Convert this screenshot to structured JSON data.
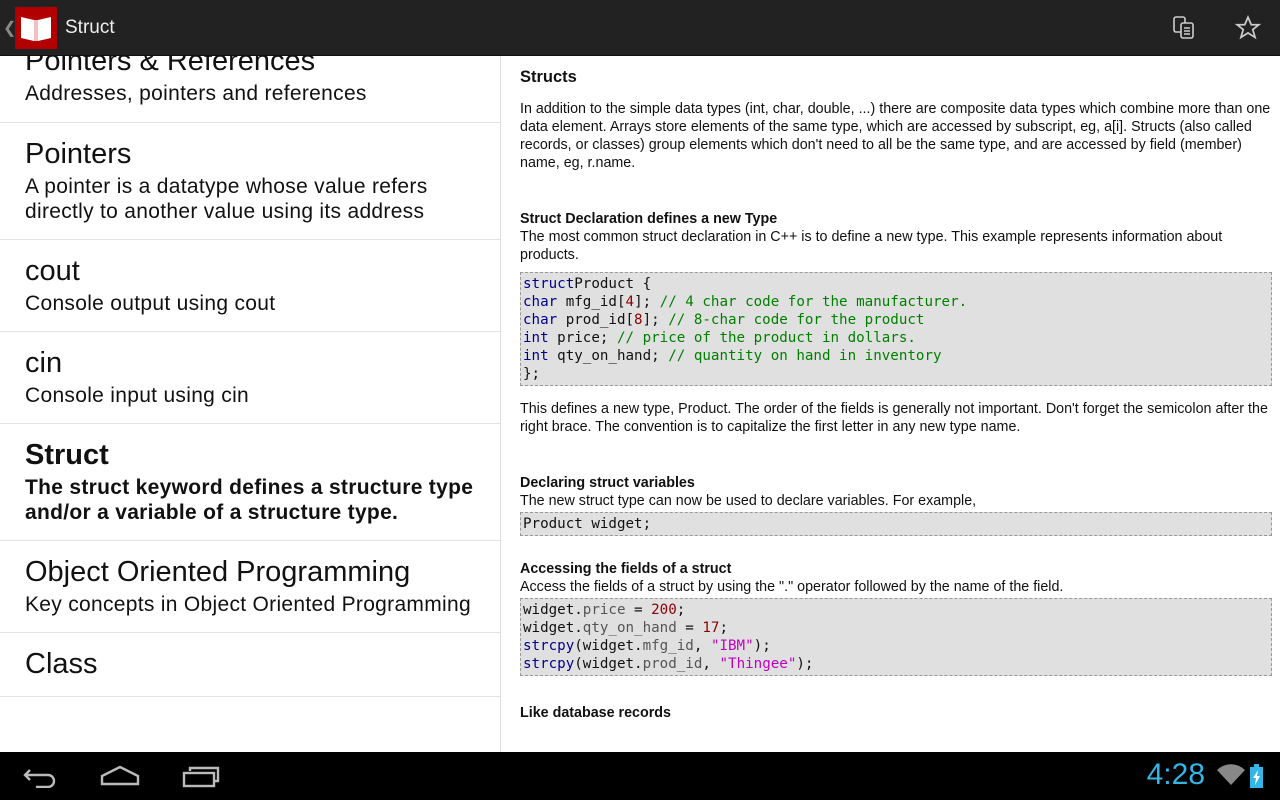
{
  "app": {
    "title": "Struct",
    "back_icon": "chevron-left-icon",
    "logo_icon": "book-icon",
    "actions": [
      "copy-icon",
      "star-icon"
    ]
  },
  "topics": [
    {
      "title": "Pointers & References",
      "desc": "Addresses, pointers and references"
    },
    {
      "title": "Pointers",
      "desc": "A pointer is a datatype whose value refers directly to another value using its address"
    },
    {
      "title": "cout",
      "desc": "Console output using cout"
    },
    {
      "title": "cin",
      "desc": "Console input using cin"
    },
    {
      "title": "Struct",
      "desc": "The struct keyword defines a structure type and/or a variable of a structure type.",
      "selected": true
    },
    {
      "title": "Object Oriented Programming",
      "desc": "Key concepts in Object Oriented Programming"
    },
    {
      "title": "Class",
      "desc": ""
    }
  ],
  "content": {
    "heading": "Structs",
    "intro": "In addition to the simple data types (int, char, double, ...) there are composite data types which combine more than one data element. Arrays store elements of the same type, which are accessed by subscript, eg, a[i]. Structs (also called records, or classes) group elements which don't need to all be the same type, and are accessed by field (member) name, eg, r.name.",
    "s1_title": "Struct Declaration defines a new Type",
    "s1_text": "The most common struct declaration in C++ is to define a new type. This example represents information about products.",
    "s1_after": "This defines a new type, Product. The order of the fields is generally not important. Don't forget the semicolon after the right brace. The convention is to capitalize the first letter in any new type name.",
    "s2_title": "Declaring struct variables",
    "s2_text": "The new struct type can now be used to declare variables. For example,",
    "s2_code": "Product widget;",
    "s3_title": "Accessing the fields of a struct",
    "s3_text": "Access the fields of a struct by using the \".\" operator followed by the name of the field.",
    "s4_title": "Like database records",
    "code1": [
      [
        [
          "kw",
          "struct"
        ],
        [
          "",
          "Product {"
        ]
      ],
      [
        [
          "kw",
          "char"
        ],
        [
          "",
          " mfg_id["
        ],
        [
          "num",
          "4"
        ],
        [
          "",
          "]; "
        ],
        [
          "cm",
          "// 4 char code for the manufacturer."
        ]
      ],
      [
        [
          "kw",
          "char"
        ],
        [
          "",
          " prod_id["
        ],
        [
          "num",
          "8"
        ],
        [
          "",
          "]; "
        ],
        [
          "cm",
          "// 8-char code for the product"
        ]
      ],
      [
        [
          "kw",
          "int"
        ],
        [
          "",
          " price; "
        ],
        [
          "cm",
          "// price of the product in dollars."
        ]
      ],
      [
        [
          "kw",
          "int"
        ],
        [
          "",
          " qty_on_hand; "
        ],
        [
          "cm",
          "// quantity on hand in inventory"
        ]
      ],
      [
        [
          "",
          "};"
        ]
      ]
    ],
    "code3": [
      [
        [
          "",
          "widget."
        ],
        [
          "fld",
          "price"
        ],
        [
          "",
          " = "
        ],
        [
          "num",
          "200"
        ],
        [
          "",
          ";"
        ]
      ],
      [
        [
          "",
          "widget."
        ],
        [
          "fld",
          "qty_on_hand"
        ],
        [
          "",
          " = "
        ],
        [
          "num",
          "17"
        ],
        [
          "",
          ";"
        ]
      ],
      [
        [
          "kw",
          "strcpy"
        ],
        [
          "",
          "(widget."
        ],
        [
          "fld",
          "mfg_id"
        ],
        [
          "",
          ", "
        ],
        [
          "str",
          "\"IBM\""
        ],
        [
          "",
          ");"
        ]
      ],
      [
        [
          "kw",
          "strcpy"
        ],
        [
          "",
          "(widget."
        ],
        [
          "fld",
          "prod_id"
        ],
        [
          "",
          ", "
        ],
        [
          "str",
          "\"Thingee\""
        ],
        [
          "",
          ");"
        ]
      ]
    ]
  },
  "status": {
    "time": "4:28",
    "icons": [
      "wifi-icon",
      "battery-charging-icon"
    ]
  },
  "nav": [
    "back-icon",
    "home-icon",
    "recent-apps-icon"
  ],
  "colors": {
    "accent": "#33b5e5",
    "logo": "#b20000",
    "keyword": "#00008b",
    "comment": "#008000",
    "number": "#8b0000",
    "string": "#c000c0"
  }
}
